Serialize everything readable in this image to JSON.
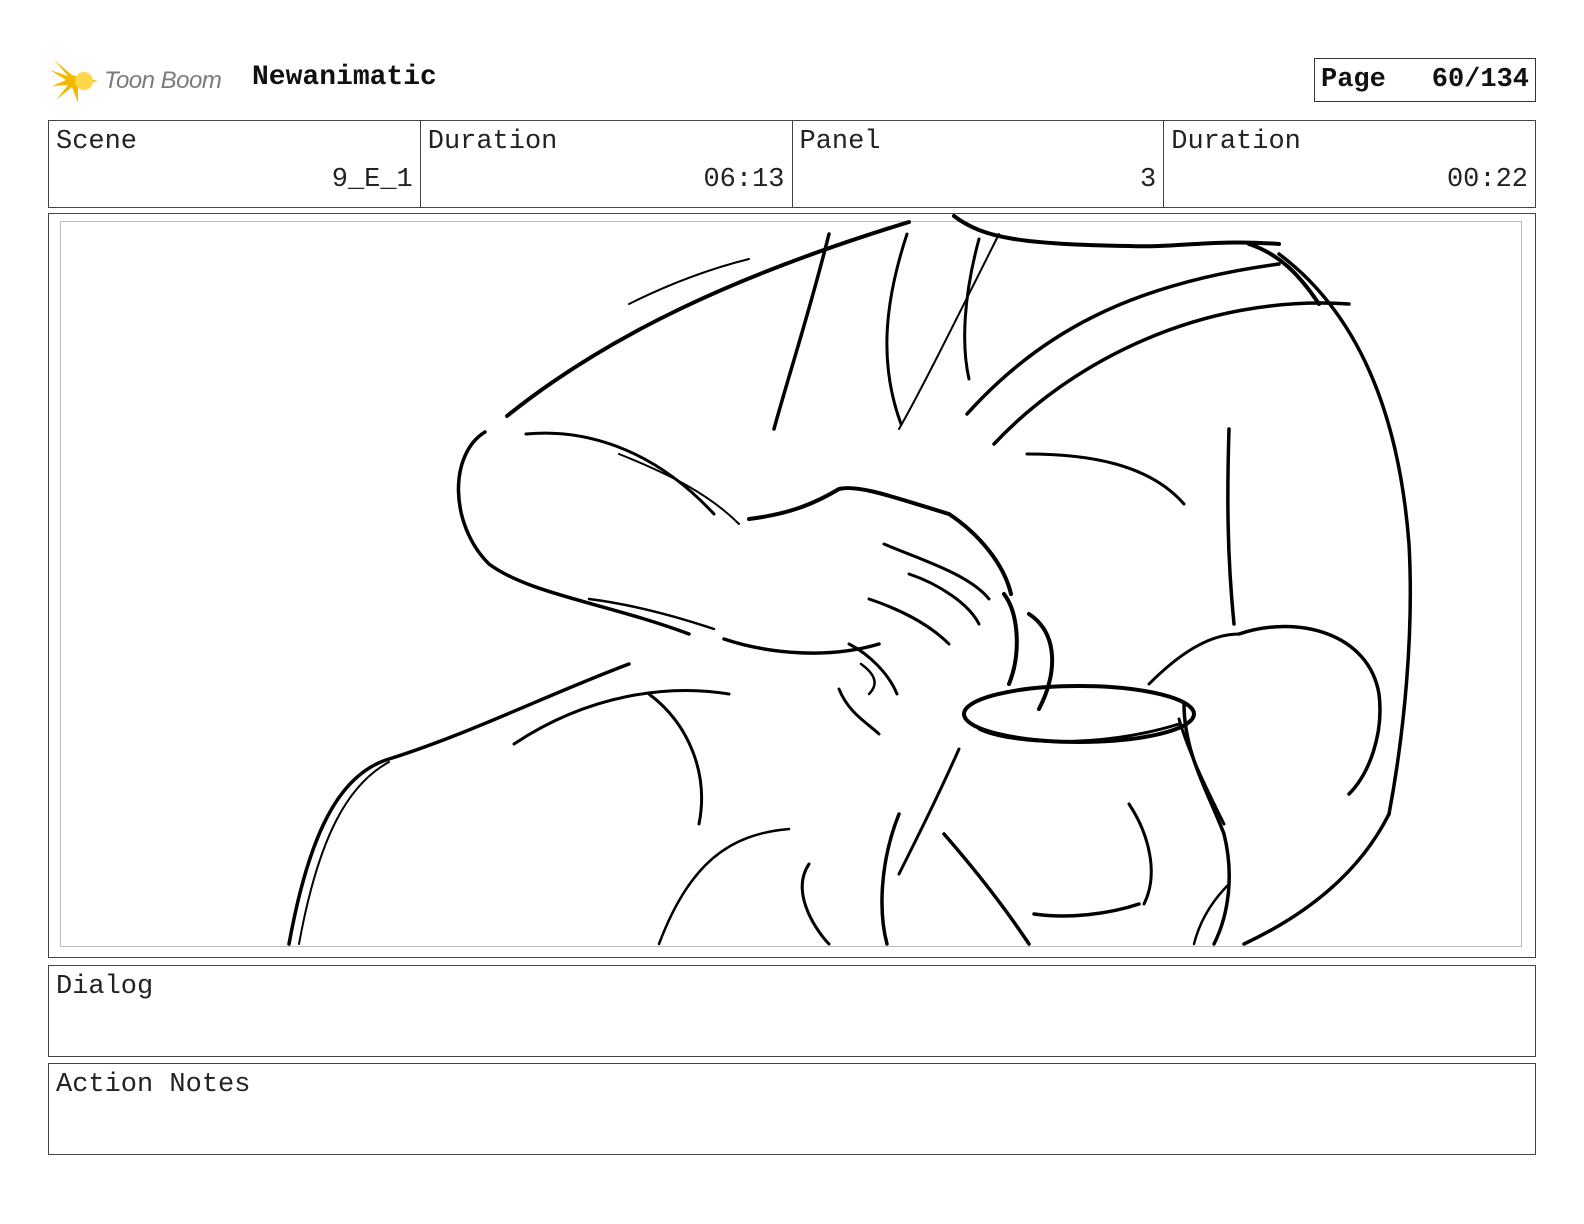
{
  "header": {
    "logo_text": "Toon Boom",
    "project_title": "Newanimatic",
    "page_label": "Page",
    "page_number": "60/134"
  },
  "info": {
    "scene_label": "Scene",
    "scene_value": "9_E_1",
    "scene_duration_label": "Duration",
    "scene_duration_value": "06:13",
    "panel_label": "Panel",
    "panel_value": "3",
    "panel_duration_label": "Duration",
    "panel_duration_value": "00:22"
  },
  "dialog": {
    "label": "Dialog"
  },
  "action_notes": {
    "label": "Action Notes"
  },
  "colors": {
    "logo_accent": "#f5b800",
    "border": "#444444",
    "sketch_line": "#000000"
  }
}
